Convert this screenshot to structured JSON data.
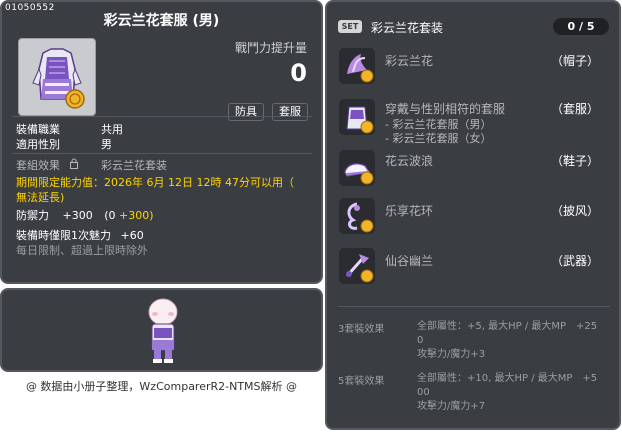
{
  "item": {
    "id": "01050552",
    "title": "彩云兰花套服 (男)",
    "combat_label": "戰鬥力提升量",
    "combat_value": "0",
    "tags": [
      "防具",
      "套服"
    ],
    "job_label": "裝備職業",
    "job_value": "共用",
    "gender_label": "適用性別",
    "gender_value": "男",
    "set_label": "套組效果",
    "set_value": "彩云兰花套装",
    "expire_label": "期間限定能力值",
    "expire_value": "：2026年 6月 12日 12時 47分可以用（",
    "expire_value2": "無法延長)",
    "defense_label": "防禦力",
    "defense_text": "+300",
    "defense_detail": "(0",
    "defense_bonus": "+300)",
    "charm_text": "裝備時僅限1次魅力",
    "charm_value": "+60",
    "limit_text": "每日限制、超過上限時除外",
    "credit": "@ 数据由小册子整理，WzComparerR2-NTMS解析 @"
  },
  "set": {
    "badge": "SET",
    "title": "彩云兰花套装",
    "count": "0 / 5",
    "parts": [
      {
        "name": "彩云兰花",
        "slot": "（帽子）",
        "icon": "hat-icon"
      },
      {
        "name": "穿戴与性别相符的套服",
        "slot": "（套服）",
        "icon": "overall-icon",
        "sub": [
          "- 彩云兰花套服（男）",
          "- 彩云兰花套服（女）"
        ]
      },
      {
        "name": "花云波浪",
        "slot": "（鞋子）",
        "icon": "shoes-icon"
      },
      {
        "name": "乐享花环",
        "slot": "（披风）",
        "icon": "cape-icon"
      },
      {
        "name": "仙谷幽兰",
        "slot": "（武器）",
        "icon": "weapon-icon"
      }
    ],
    "effects": [
      {
        "label": "3套裝效果",
        "line1": "全部屬性：+5, 最大HP / 最大MP　+25",
        "line2": "0",
        "line3": "攻擊力/魔力+3"
      },
      {
        "label": "5套裝效果",
        "line1": "全部屬性：+10, 最大HP / 最大MP　+5",
        "line2": "00",
        "line3": "攻擊力/魔力+7"
      }
    ]
  },
  "colors": {
    "panel_bg": "#3a3d42",
    "panel_border": "#55585e",
    "highlight": "#ffd400",
    "dim_text": "#b5b7bb"
  }
}
